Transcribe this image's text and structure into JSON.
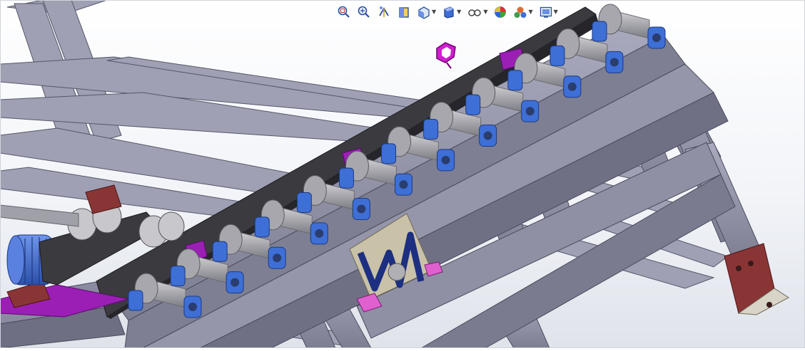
{
  "window": {
    "background_top": "#ffffff",
    "background_bottom": "#dfe3ea"
  },
  "toolbar": {
    "buttons": [
      {
        "icon": "zoom-to-fit-icon",
        "has_dropdown": false
      },
      {
        "icon": "zoom-to-area-icon",
        "has_dropdown": false
      },
      {
        "icon": "previous-view-icon",
        "has_dropdown": false
      },
      {
        "icon": "section-view-icon",
        "has_dropdown": false
      },
      {
        "icon": "view-orientation-icon",
        "has_dropdown": true
      },
      {
        "icon": "display-style-icon",
        "has_dropdown": true
      },
      {
        "icon": "hide-show-items-icon",
        "has_dropdown": true
      },
      {
        "icon": "edit-appearance-icon",
        "has_dropdown": false
      },
      {
        "icon": "apply-scene-icon",
        "has_dropdown": true
      },
      {
        "icon": "view-settings-icon",
        "has_dropdown": true
      }
    ]
  },
  "model": {
    "colors": {
      "steel_face": "#8e8fa3",
      "steel_light": "#a9aabd",
      "steel_dark": "#5e5f70",
      "bearing_blue": "#3e6fd6",
      "roller_gray": "#a7a7ad",
      "belt_dark": "#3a3a3f",
      "plate_purple": "#9b1fb5",
      "bracket_brown": "#8a3535",
      "handle_magenta": "#d01fd0"
    },
    "roller_count": 12
  }
}
